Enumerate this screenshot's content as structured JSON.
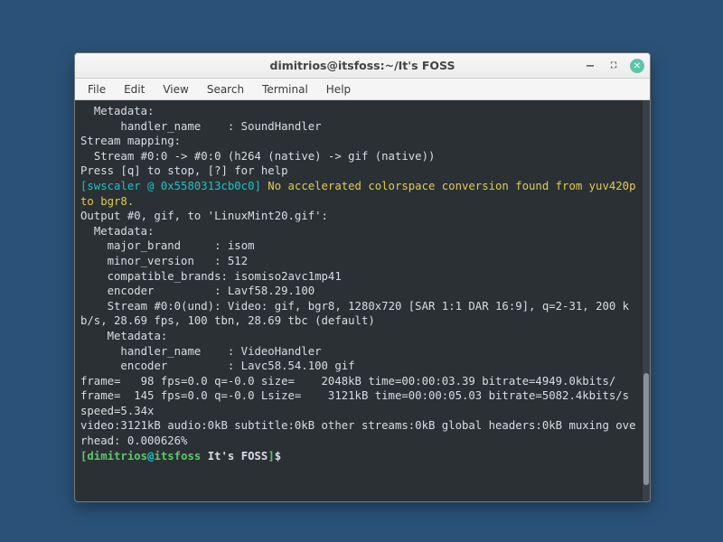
{
  "window": {
    "title": "dimitrios@itsfoss:~/It's FOSS",
    "controls": {
      "min": "−",
      "max": "⛶",
      "close": "✕"
    }
  },
  "menubar": [
    "File",
    "Edit",
    "View",
    "Search",
    "Terminal",
    "Help"
  ],
  "out": {
    "l01": "  Metadata:",
    "l02": "      handler_name    : SoundHandler",
    "l03": "Stream mapping:",
    "l04": "  Stream #0:0 -> #0:0 (h264 (native) -> gif (native))",
    "l05": "Press [q] to stop, [?] for help",
    "l06a": "[swscaler @ 0x5580313cb0c0] ",
    "l06b": "No accelerated colorspace conversion found from yuv420p to bgr8.",
    "l07": "Output #0, gif, to 'LinuxMint20.gif':",
    "l08": "  Metadata:",
    "l09": "    major_brand     : isom",
    "l10": "    minor_version   : 512",
    "l11": "    compatible_brands: isomiso2avc1mp41",
    "l12": "    encoder         : Lavf58.29.100",
    "l13": "    Stream #0:0(und): Video: gif, bgr8, 1280x720 [SAR 1:1 DAR 16:9], q=2-31, 200 kb/s, 28.69 fps, 100 tbn, 28.69 tbc (default)",
    "l14": "    Metadata:",
    "l15": "      handler_name    : VideoHandler",
    "l16": "      encoder         : Lavc58.54.100 gif",
    "l17": "frame=   98 fps=0.0 q=-0.0 size=    2048kB time=00:00:03.39 bitrate=4949.0kbits/",
    "l18": "frame=  145 fps=0.0 q=-0.0 Lsize=    3121kB time=00:00:05.03 bitrate=5082.4kbits/s speed=5.34x",
    "l19": "video:3121kB audio:0kB subtitle:0kB other streams:0kB global headers:0kB muxing overhead: 0.000626%"
  },
  "prompt": {
    "lb": "[",
    "user": "dimitrios",
    "at": "@",
    "host": "itsfoss",
    "sp": " ",
    "dir": "It's FOSS",
    "rb": "]",
    "dollar": "$"
  }
}
